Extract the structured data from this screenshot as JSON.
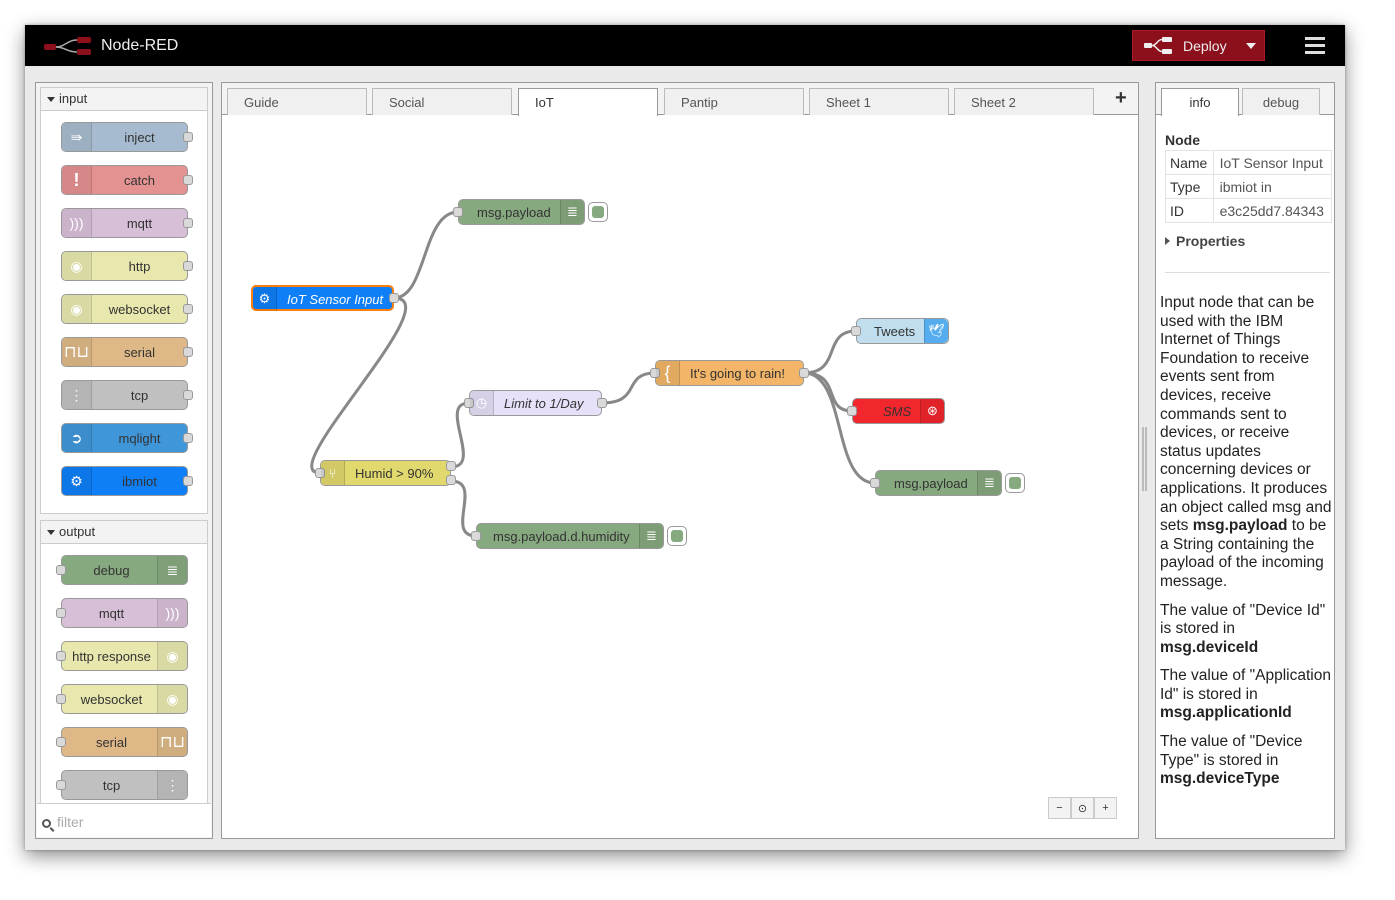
{
  "app": {
    "title": "Node-RED",
    "deploy_label": "Deploy"
  },
  "colors": {
    "header_bg": "#000000",
    "deploy_bg": "#8c101c",
    "inject": "#a6bbcf",
    "catch": "#e49191",
    "mqtt": "#d8bfd8",
    "http": "#e7e7ae",
    "serial": "#deb887",
    "tcp": "#c0c0c0",
    "mqlight": "#3f96d8",
    "ibmiot": "#0f7ff7",
    "debug": "#87a980",
    "twitter": "#c0deed",
    "sms": "#f2262d",
    "function": "#f3b567",
    "delay": "#e6e0f8",
    "switch": "#e2d96e"
  },
  "palette": {
    "input_header": "input",
    "output_header": "output",
    "filter_placeholder": "filter",
    "input_nodes": [
      {
        "label": "inject",
        "icon": "arrow-right-icon"
      },
      {
        "label": "catch",
        "icon": "alert-icon"
      },
      {
        "label": "mqtt",
        "icon": "bridge-icon"
      },
      {
        "label": "http",
        "icon": "globe-icon"
      },
      {
        "label": "websocket",
        "icon": "globe-icon"
      },
      {
        "label": "serial",
        "icon": "serial-icon"
      },
      {
        "label": "tcp",
        "icon": "bridge-dash-icon"
      },
      {
        "label": "mqlight",
        "icon": "mqlight-icon"
      },
      {
        "label": "ibmiot",
        "icon": "ibmiot-icon"
      }
    ],
    "output_nodes": [
      {
        "label": "debug",
        "icon": "debug-icon"
      },
      {
        "label": "mqtt",
        "icon": "bridge-icon"
      },
      {
        "label": "http response",
        "icon": "globe-icon"
      },
      {
        "label": "websocket",
        "icon": "globe-icon"
      },
      {
        "label": "serial",
        "icon": "serial-icon"
      },
      {
        "label": "tcp",
        "icon": "bridge-dash-icon"
      }
    ]
  },
  "workspace": {
    "tabs": [
      "Guide",
      "Social",
      "IoT",
      "Pantip",
      "Sheet 1",
      "Sheet 2"
    ],
    "active_tab": "IoT",
    "flow_nodes": {
      "msg_payload_top": "msg.payload",
      "iot_sensor": "IoT Sensor Input",
      "humid": "Humid > 90%",
      "limit": "Limit to 1/Day",
      "rain": "It's going to rain!",
      "tweets": "Tweets",
      "sms": "SMS",
      "msg_payload_right": "msg.payload",
      "humidity": "msg.payload.d.humidity"
    }
  },
  "sidebar": {
    "tabs": [
      "info",
      "debug"
    ],
    "active_tab": "info",
    "section_title": "Node",
    "table": [
      {
        "key": "Name",
        "value": "IoT Sensor Input"
      },
      {
        "key": "Type",
        "value": "ibmiot in"
      },
      {
        "key": "ID",
        "value": "e3c25dd7.84343"
      }
    ],
    "properties_label": "Properties",
    "desc1_pre": "Input node that can be used with the IBM Internet of Things Foundation to receive events sent from devices, receive commands sent to devices, or receive status updates concerning devices or applications. It produces an object called msg and sets ",
    "desc1_bold": "msg.payload",
    "desc1_post": " to be a String containing the payload of the incoming message.",
    "desc2_pre": "The value of \"Device Id\" is stored in ",
    "desc2_bold": "msg.deviceId",
    "desc3_pre": "The value of \"Application Id\" is stored in ",
    "desc3_bold": "msg.applicationId",
    "desc4_pre": "The value of \"Device Type\" is stored in ",
    "desc4_bold": "msg.deviceType"
  }
}
